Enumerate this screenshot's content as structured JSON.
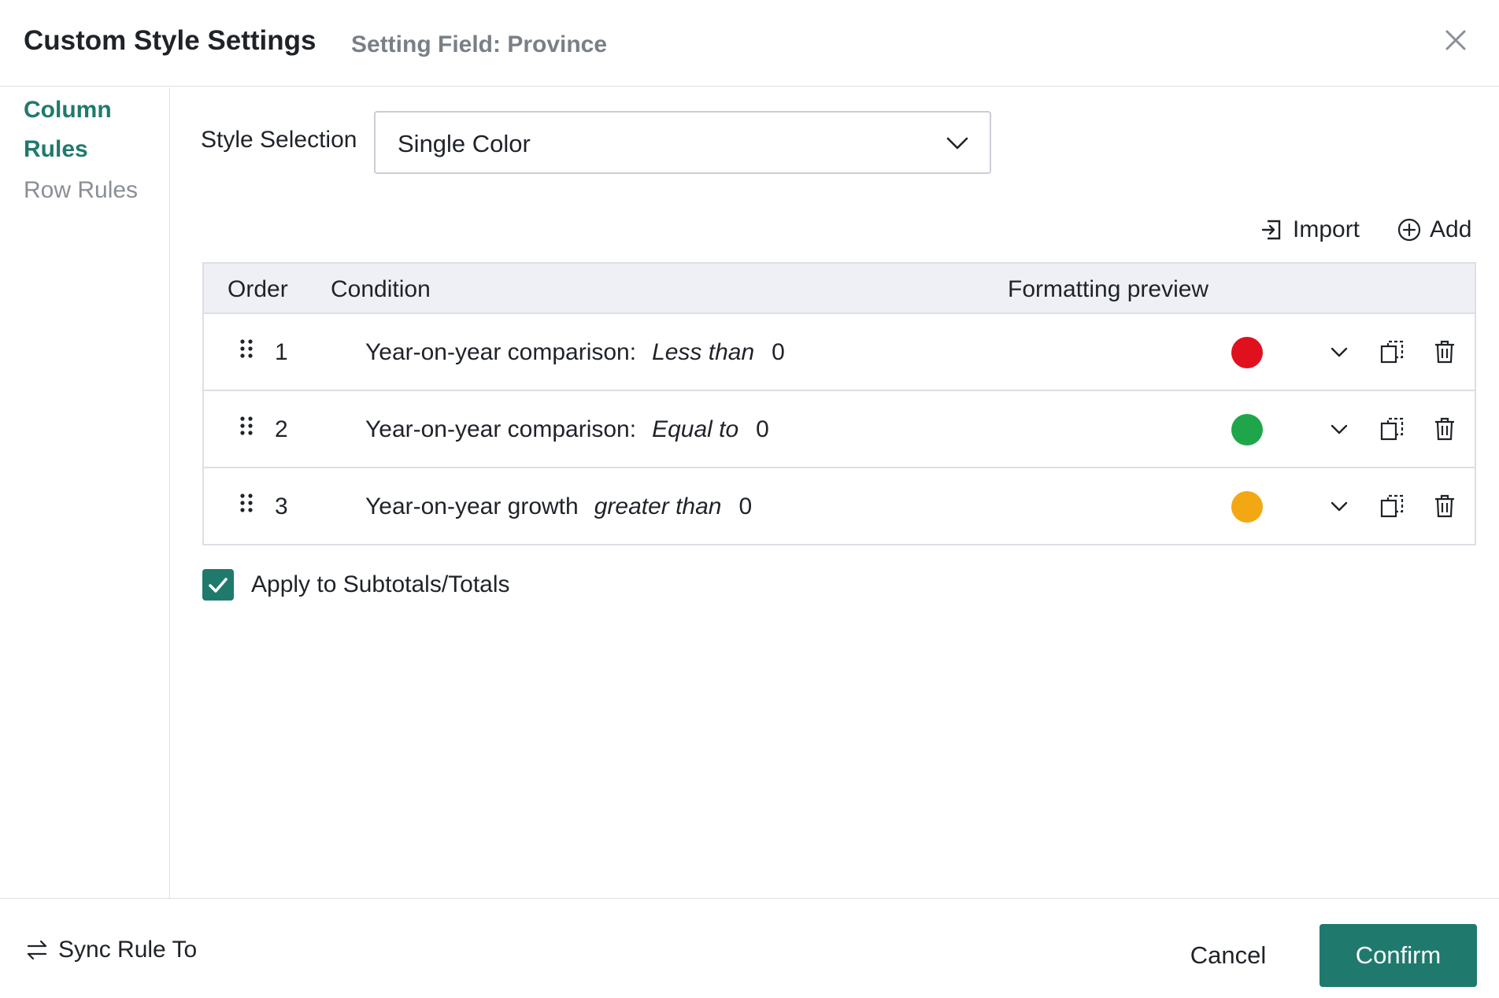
{
  "header": {
    "title": "Custom Style Settings",
    "subtitle": "Setting Field: Province"
  },
  "sidebar": {
    "items": [
      {
        "label": "Column Rules",
        "active": true
      },
      {
        "label": "Row Rules",
        "active": false
      }
    ]
  },
  "style_selection": {
    "label": "Style Selection",
    "value": "Single Color"
  },
  "toolbar": {
    "import_label": "Import",
    "add_label": "Add"
  },
  "table": {
    "headers": {
      "order": "Order",
      "condition": "Condition",
      "preview": "Formatting preview"
    },
    "rows": [
      {
        "order": "1",
        "field": "Year-on-year comparison:",
        "operator": "Less than",
        "value": "0",
        "color": "#e0101e"
      },
      {
        "order": "2",
        "field": "Year-on-year comparison:",
        "operator": "Equal to",
        "value": "0",
        "color": "#1fa54a"
      },
      {
        "order": "3",
        "field": "Year-on-year growth",
        "operator": "greater than",
        "value": "0",
        "color": "#f3a712"
      }
    ]
  },
  "apply": {
    "label": "Apply to Subtotals/Totals",
    "checked": true
  },
  "footer": {
    "sync_label": "Sync Rule To",
    "cancel_label": "Cancel",
    "confirm_label": "Confirm"
  },
  "colors": {
    "accent": "#1f7a6d",
    "border": "#dcdfe4",
    "header_bg": "#eef0f5"
  },
  "icons": {
    "close": "close-icon",
    "select": "chevron-down-icon",
    "import": "import-icon",
    "add": "plus-circle-icon",
    "drag": "drag-handle-icon",
    "copy": "copy-icon",
    "delete": "trash-icon",
    "sync": "swap-arrows-icon",
    "check": "checkmark-icon"
  }
}
